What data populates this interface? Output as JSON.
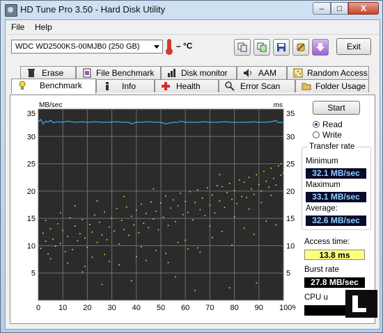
{
  "window": {
    "title": "HD Tune Pro 3.50 - Hard Disk Utility",
    "controls": {
      "minimize": "–",
      "maximize": "□",
      "close": "X"
    }
  },
  "menu": {
    "file": "File",
    "help": "Help"
  },
  "toolbar": {
    "drive": "WDC WD2500KS-00MJB0 (250 GB)",
    "temperature": "– °C",
    "buttons": [
      "copy-icon",
      "copy-info-icon",
      "save-icon",
      "options-icon",
      "download-icon"
    ],
    "exit_label": "Exit"
  },
  "tabs": {
    "row_top": [
      "Erase",
      "File Benchmark",
      "Disk monitor",
      "AAM",
      "Random Access"
    ],
    "row_bottom": [
      "Benchmark",
      "Info",
      "Health",
      "Error Scan",
      "Folder Usage"
    ],
    "active": "Benchmark"
  },
  "side": {
    "start_label": "Start",
    "read_label": "Read",
    "write_label": "Write",
    "selected_mode": "Read",
    "transfer_rate_title": "Transfer rate",
    "minimum_label": "Minimum",
    "minimum_value": "32.1 MB/sec",
    "maximum_label": "Maximum",
    "maximum_value": "33.1 MB/sec",
    "average_label": "Average:",
    "average_value": "32.6 MB/sec",
    "access_time_label": "Access time:",
    "access_time_value": "13.8 ms",
    "burst_rate_label": "Burst rate",
    "burst_rate_value": "27.8 MB/sec",
    "cpu_label": "CPU u",
    "cpu_value": ""
  },
  "chart_data": {
    "type": "line",
    "left_unit": "MB/sec",
    "right_unit": "ms",
    "ylim": [
      0,
      35
    ],
    "yticks": [
      5,
      10,
      15,
      20,
      25,
      30,
      35
    ],
    "xlim": [
      0,
      100
    ],
    "xticks": [
      0,
      10,
      20,
      30,
      40,
      50,
      60,
      70,
      80,
      90,
      100
    ],
    "x_last_label": "100%",
    "grid": true,
    "background": "#2b2b2b",
    "grid_color": "#6f6f6f",
    "series": [
      {
        "kind": "line",
        "color": "#3aa7e8",
        "x": [
          0,
          1,
          2,
          3,
          4,
          5,
          6,
          8,
          10,
          12,
          15,
          18,
          20,
          23,
          26,
          29,
          32,
          35,
          37,
          38,
          40,
          42,
          45,
          48,
          50,
          52,
          55,
          57,
          58,
          60,
          62,
          65,
          68,
          70,
          73,
          76,
          79,
          82,
          85,
          88,
          90,
          92,
          95,
          97,
          98,
          100
        ],
        "y": [
          32.7,
          33.1,
          32.3,
          32.8,
          32.6,
          33.0,
          32.5,
          32.7,
          32.6,
          32.8,
          32.6,
          32.7,
          32.6,
          32.7,
          32.6,
          32.6,
          32.7,
          32.6,
          32.6,
          32.3,
          32.6,
          32.6,
          32.7,
          32.6,
          32.6,
          32.3,
          32.6,
          32.6,
          32.8,
          32.6,
          32.6,
          32.6,
          32.7,
          32.6,
          32.6,
          32.7,
          32.6,
          32.6,
          32.6,
          32.7,
          32.6,
          32.6,
          32.7,
          32.9,
          32.5,
          32.6
        ]
      },
      {
        "kind": "scatter",
        "color": "#e6e64a",
        "description_points": [
          [
            1,
            9.5
          ],
          [
            2,
            12.3
          ],
          [
            3,
            10.8
          ],
          [
            4,
            8.5
          ],
          [
            5,
            13.1
          ],
          [
            6,
            11.2
          ],
          [
            7,
            9.9
          ],
          [
            8,
            14.0
          ],
          [
            9,
            10.4
          ],
          [
            10,
            12.8
          ],
          [
            11,
            8.9
          ],
          [
            12,
            11.7
          ],
          [
            13,
            15.1
          ],
          [
            14,
            9.3
          ],
          [
            15,
            13.6
          ],
          [
            16,
            10.9
          ],
          [
            17,
            12.2
          ],
          [
            18,
            14.8
          ],
          [
            19,
            11.4
          ],
          [
            20,
            9.7
          ],
          [
            21,
            13.9
          ],
          [
            22,
            12.5
          ],
          [
            23,
            15.6
          ],
          [
            24,
            10.6
          ],
          [
            25,
            14.3
          ],
          [
            26,
            12.0
          ],
          [
            27,
            16.2
          ],
          [
            28,
            11.1
          ],
          [
            29,
            13.4
          ],
          [
            30,
            15.0
          ],
          [
            31,
            12.7
          ],
          [
            32,
            16.8
          ],
          [
            33,
            10.3
          ],
          [
            34,
            14.6
          ],
          [
            35,
            13.0
          ],
          [
            36,
            17.1
          ],
          [
            37,
            11.9
          ],
          [
            38,
            15.4
          ],
          [
            39,
            13.8
          ],
          [
            40,
            16.5
          ],
          [
            41,
            12.4
          ],
          [
            42,
            17.6
          ],
          [
            43,
            14.1
          ],
          [
            44,
            15.9
          ],
          [
            45,
            13.3
          ],
          [
            46,
            18.0
          ],
          [
            47,
            14.9
          ],
          [
            48,
            16.3
          ],
          [
            49,
            12.9
          ],
          [
            50,
            17.8
          ],
          [
            51,
            15.2
          ],
          [
            52,
            19.1
          ],
          [
            53,
            13.7
          ],
          [
            54,
            16.9
          ],
          [
            55,
            18.4
          ],
          [
            56,
            14.4
          ],
          [
            57,
            17.3
          ],
          [
            58,
            19.6
          ],
          [
            59,
            15.7
          ],
          [
            60,
            18.1
          ],
          [
            61,
            16.1
          ],
          [
            62,
            19.9
          ],
          [
            63,
            14.7
          ],
          [
            64,
            17.9
          ],
          [
            65,
            20.2
          ],
          [
            66,
            16.6
          ],
          [
            67,
            18.7
          ],
          [
            68,
            15.5
          ],
          [
            69,
            20.6
          ],
          [
            70,
            17.4
          ],
          [
            71,
            19.3
          ],
          [
            72,
            16.0
          ],
          [
            73,
            21.0
          ],
          [
            74,
            18.2
          ],
          [
            75,
            20.8
          ],
          [
            76,
            17.0
          ],
          [
            77,
            19.7
          ],
          [
            78,
            21.4
          ],
          [
            79,
            18.5
          ],
          [
            80,
            20.1
          ],
          [
            81,
            17.7
          ],
          [
            82,
            22.0
          ],
          [
            83,
            19.0
          ],
          [
            84,
            21.6
          ],
          [
            85,
            18.8
          ],
          [
            86,
            22.5
          ],
          [
            87,
            20.4
          ],
          [
            88,
            19.4
          ],
          [
            89,
            23.0
          ],
          [
            90,
            21.2
          ],
          [
            91,
            20.0
          ],
          [
            92,
            23.6
          ],
          [
            93,
            21.8
          ],
          [
            94,
            20.7
          ],
          [
            95,
            24.2
          ],
          [
            96,
            22.3
          ],
          [
            97,
            21.1
          ],
          [
            98,
            24.6
          ],
          [
            99,
            22.9
          ],
          [
            100,
            23.3
          ],
          [
            5,
            7.6
          ],
          [
            12,
            6.8
          ],
          [
            18,
            5.2
          ],
          [
            22,
            7.9
          ],
          [
            27,
            8.4
          ],
          [
            33,
            6.5
          ],
          [
            40,
            8.0
          ],
          [
            44,
            7.3
          ],
          [
            48,
            9.1
          ],
          [
            53,
            6.9
          ],
          [
            57,
            10.6
          ],
          [
            61,
            9.4
          ],
          [
            66,
            8.8
          ],
          [
            71,
            11.5
          ],
          [
            75,
            12.6
          ],
          [
            79,
            10.1
          ],
          [
            84,
            13.2
          ],
          [
            88,
            12.1
          ],
          [
            93,
            14.5
          ],
          [
            97,
            13.8
          ],
          [
            3,
            14.6
          ],
          [
            9,
            16.0
          ],
          [
            15,
            17.3
          ],
          [
            19,
            6.2
          ],
          [
            24,
            18.2
          ],
          [
            29,
            7.1
          ],
          [
            35,
            19.0
          ],
          [
            42,
            9.8
          ],
          [
            47,
            20.4
          ],
          [
            52,
            8.6
          ],
          [
            60,
            11.0
          ],
          [
            65,
            9.6
          ],
          [
            70,
            13.6
          ],
          [
            74,
            23.0
          ],
          [
            80,
            15.3
          ],
          [
            86,
            16.7
          ],
          [
            91,
            17.9
          ],
          [
            95,
            19.2
          ],
          [
            99,
            25.0
          ],
          [
            56,
            4.3
          ],
          [
            38,
            3.6
          ],
          [
            78,
            2.3
          ],
          [
            64,
            1.8
          ],
          [
            26,
            2.9
          ],
          [
            89,
            3.2
          ]
        ]
      }
    ]
  }
}
